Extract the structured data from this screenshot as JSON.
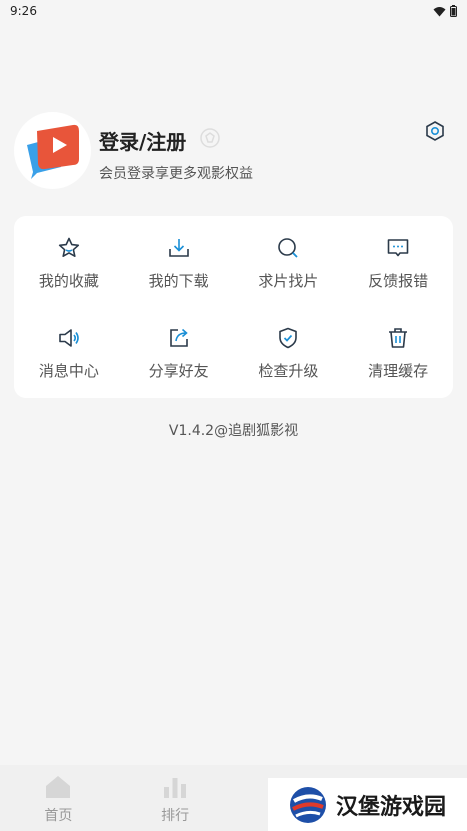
{
  "status_bar": {
    "time": "9:26"
  },
  "profile": {
    "title": "登录/注册",
    "subtitle": "会员登录享更多观影权益"
  },
  "menu": {
    "items": [
      {
        "label": "我的收藏",
        "icon": "star-icon"
      },
      {
        "label": "我的下载",
        "icon": "download-icon"
      },
      {
        "label": "求片找片",
        "icon": "search-icon"
      },
      {
        "label": "反馈报错",
        "icon": "feedback-icon"
      },
      {
        "label": "消息中心",
        "icon": "speaker-icon"
      },
      {
        "label": "分享好友",
        "icon": "share-icon"
      },
      {
        "label": "检查升级",
        "icon": "shield-check-icon"
      },
      {
        "label": "清理缓存",
        "icon": "trash-icon"
      }
    ]
  },
  "version": "V1.4.2@追剧狐影视",
  "tabs": [
    {
      "label": "首页"
    },
    {
      "label": "排行"
    }
  ],
  "watermark": {
    "text": "汉堡游戏园"
  },
  "colors": {
    "accent": "#1a8fd6",
    "icon_dark": "#2b3a4a",
    "card": "#ffffff",
    "background": "#f5f5f5"
  }
}
